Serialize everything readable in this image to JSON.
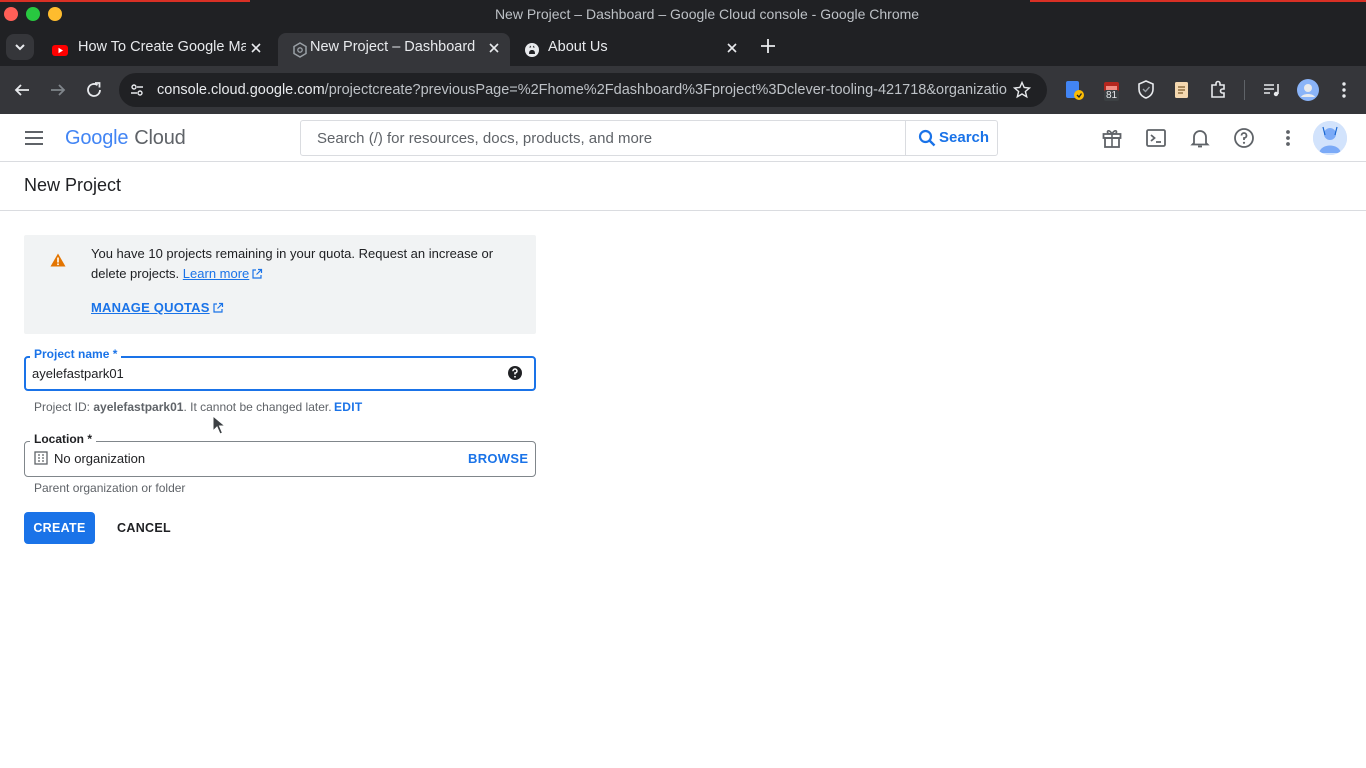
{
  "window": {
    "title": "New Project – Dashboard – Google Cloud console - Google Chrome"
  },
  "tabs": [
    {
      "title": "How To Create Google Maps",
      "favicon": "youtube-icon",
      "active": false
    },
    {
      "title": "New Project – Dashboard",
      "favicon": "cloud-favicon-icon",
      "active": true
    },
    {
      "title": "About Us",
      "favicon": "github-icon",
      "active": false
    }
  ],
  "omnibox": {
    "host": "console.cloud.google.com",
    "path": "/projectcreate?previousPage=%2Fhome%2Fdashboard%3Fproject%3Dclever-tooling-421718&organizatio..."
  },
  "extensions": {
    "badge_count": "81"
  },
  "gcp_header": {
    "logo_google": "Google",
    "logo_cloud": "Cloud",
    "search_placeholder": "Search (/) for resources, docs, products, and more",
    "search_button": "Search"
  },
  "page": {
    "title": "New Project"
  },
  "quota_notice": {
    "message": "You have 10 projects remaining in your quota. Request an increase or delete projects.",
    "learn_more": "Learn more",
    "manage_quotas": "MANAGE QUOTAS"
  },
  "project_name": {
    "label": "Project name *",
    "value": "ayelefastpark01",
    "id_prefix": "Project ID:",
    "id_value": "ayelefastpark01",
    "id_suffix": ". It cannot be changed later.",
    "edit": "EDIT"
  },
  "location": {
    "label": "Location *",
    "value": "No organization",
    "browse": "BROWSE",
    "hint": "Parent organization or folder"
  },
  "actions": {
    "create": "CREATE",
    "cancel": "CANCEL"
  },
  "colors": {
    "accent": "#1a73e8",
    "warning": "#e37400",
    "chrome_dark": "#202124",
    "chrome_toolbar": "#35363a"
  }
}
